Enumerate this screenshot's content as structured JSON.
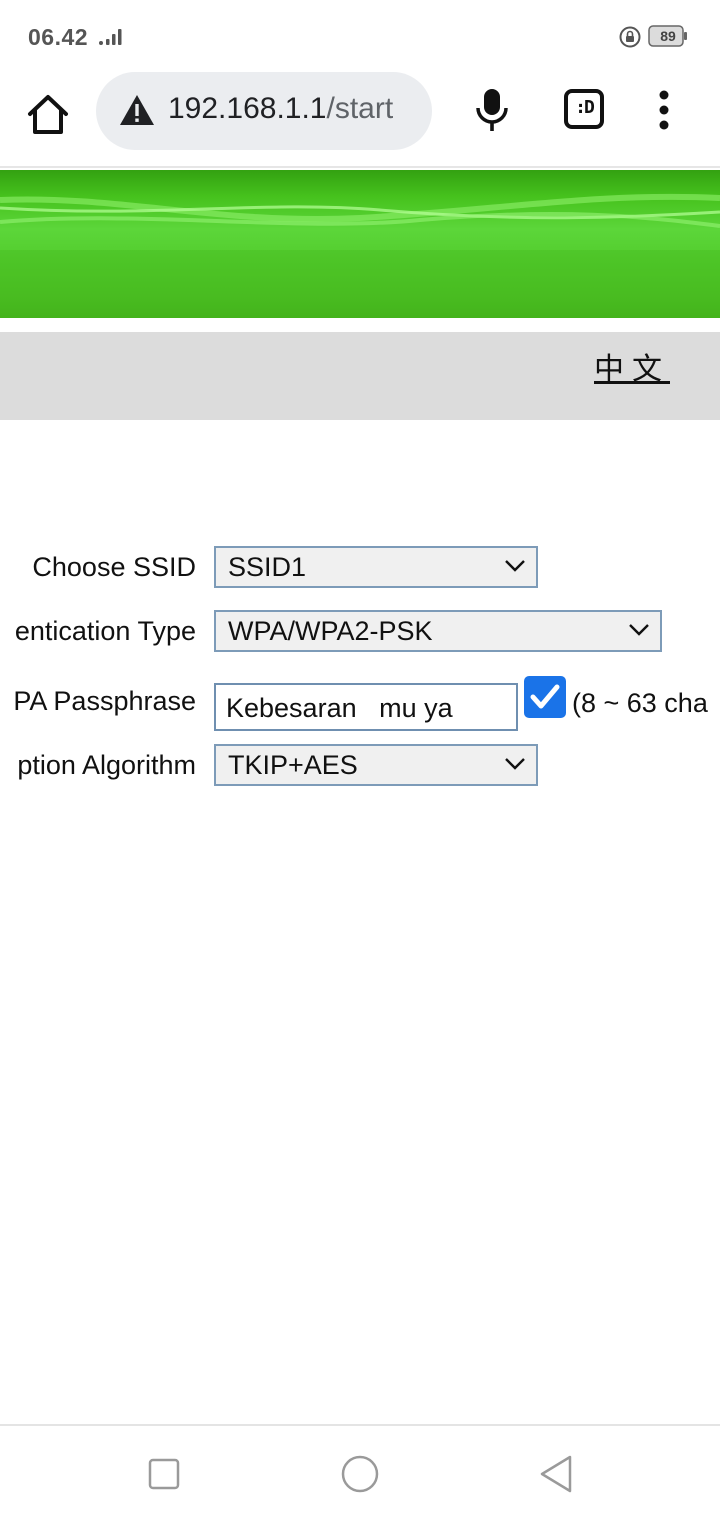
{
  "status_bar": {
    "time": "06.42",
    "battery_level": "89",
    "icons": [
      "signal-icon",
      "rotation-lock-icon",
      "battery-icon"
    ]
  },
  "browser": {
    "url_host": "192.168.1.1",
    "url_path": "/start",
    "tabs_icon": ":D",
    "icons": [
      "home-icon",
      "warning-icon",
      "mic-icon",
      "tabs-icon",
      "more-vert-icon"
    ]
  },
  "page": {
    "language_link": "中文",
    "form": {
      "ssid_label": "Choose SSID",
      "ssid_value": "SSID1",
      "auth_label": "entication Type",
      "auth_value": "WPA/WPA2-PSK",
      "passphrase_label": "PA Passphrase",
      "passphrase_value": "Kebesaran   mu ya",
      "show_passphrase_checked": true,
      "passphrase_hint": "(8 ~ 63 cha",
      "algorithm_label": "ption Algorithm",
      "algorithm_value": "TKIP+AES"
    }
  },
  "nav_bar": {
    "icons": [
      "recents-square-icon",
      "home-circle-icon",
      "back-triangle-icon"
    ]
  },
  "colors": {
    "banner_green": "#46c21d",
    "lang_bar_gray": "#dcdcdc",
    "checkbox_blue": "#1a73e8",
    "select_border": "#7d9bb8"
  }
}
